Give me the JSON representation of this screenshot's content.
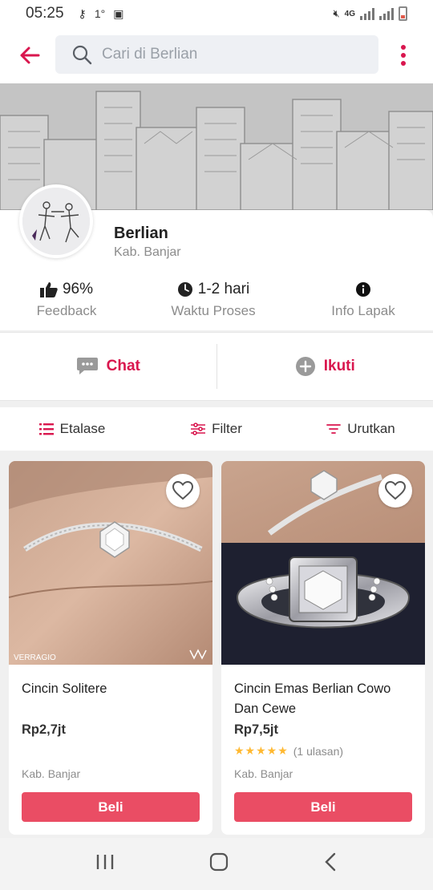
{
  "status_bar": {
    "time": "05:25",
    "temp": "1°",
    "network": "4G"
  },
  "header": {
    "search_placeholder": "Cari di Berlian"
  },
  "shop": {
    "name": "Berlian",
    "location": "Kab. Banjar",
    "stats": [
      {
        "value": "96%",
        "label": "Feedback",
        "icon": "thumbs-up-icon"
      },
      {
        "value": "1-2 hari",
        "label": "Waktu Proses",
        "icon": "clock-icon"
      },
      {
        "value": "",
        "label": "Info Lapak",
        "icon": "info-icon"
      }
    ]
  },
  "actions": {
    "chat": "Chat",
    "follow": "Ikuti"
  },
  "toolbar": {
    "etalase": "Etalase",
    "filter": "Filter",
    "sort": "Urutkan"
  },
  "products": [
    {
      "name": "Cincin Solitere",
      "price": "Rp2,7jt",
      "location": "Kab. Banjar",
      "buy": "Beli",
      "watermark": "VERRAGIO"
    },
    {
      "name": "Cincin Emas Berlian Cowo Dan Cewe",
      "price": "Rp7,5jt",
      "rating_stars": 5,
      "reviews": "(1 ulasan)",
      "location": "Kab. Banjar",
      "buy": "Beli"
    }
  ],
  "colors": {
    "accent": "#d9164e",
    "buy_button": "#ea4d64",
    "star": "#ffb932"
  }
}
